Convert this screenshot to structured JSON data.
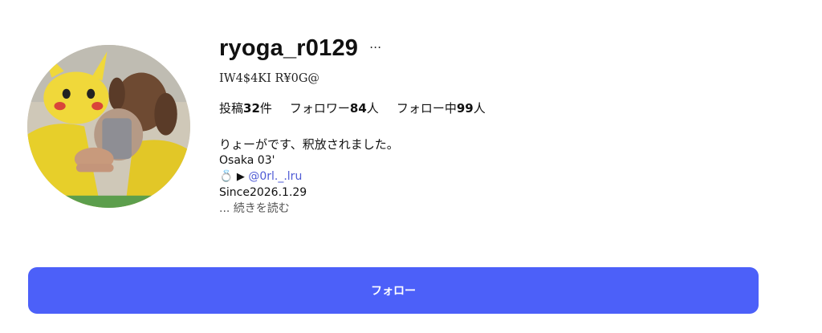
{
  "profile": {
    "username": "ryoga_r0129",
    "more_icon": "…",
    "display_name": "IW4$4KI R¥0G@"
  },
  "stats": {
    "posts_label": "投稿",
    "posts_count": "32",
    "posts_unit": "件",
    "followers_label": "フォロワー",
    "followers_count": "84",
    "followers_unit": "人",
    "following_label": "フォロー中",
    "following_count": "99",
    "following_unit": "人"
  },
  "bio": {
    "line1": "りょーがです、釈放されました。",
    "line2": "Osaka 03'",
    "ring_icon": "💍",
    "play_icon": "▶",
    "mention": "@0rl._.lru",
    "line4": "Since2026.1.29",
    "read_more": "... 続きを読む"
  },
  "actions": {
    "follow_label": "フォロー"
  },
  "colors": {
    "accent": "#4c60f9",
    "link": "#4f5bd5"
  }
}
